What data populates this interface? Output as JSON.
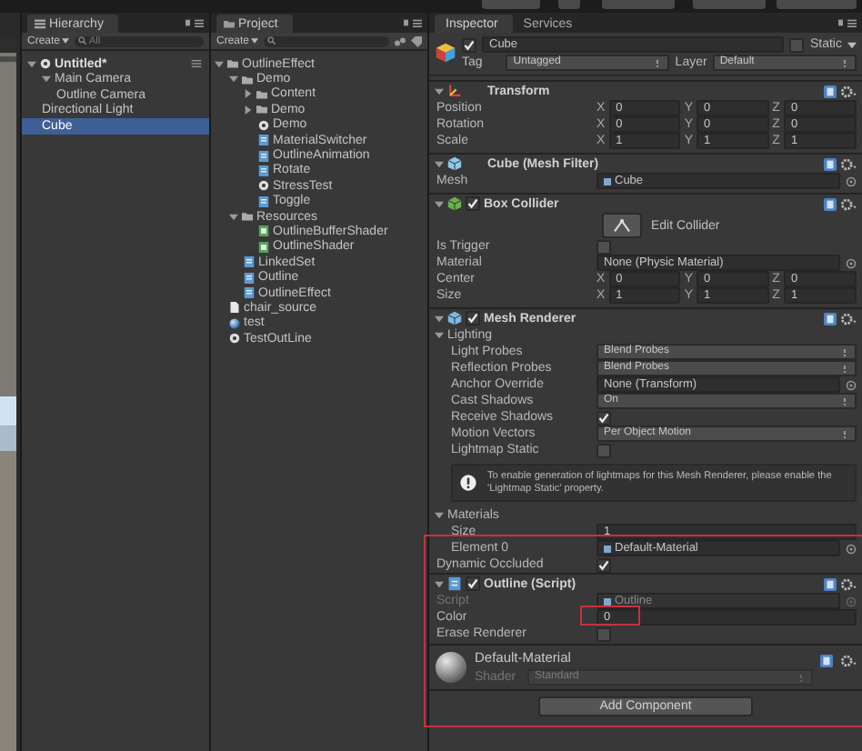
{
  "hierarchy": {
    "title": "Hierarchy",
    "create": "Create",
    "search_placeholder": "All",
    "items": [
      {
        "label": "Untitled*",
        "kind": "scene",
        "expanded": true,
        "selected": false,
        "children": [
          {
            "label": "Main Camera",
            "expanded": true,
            "selected": false,
            "children": [
              {
                "label": "Outline Camera",
                "selected": false
              }
            ]
          },
          {
            "label": "Directional Light",
            "selected": false
          },
          {
            "label": "Cube",
            "selected": true
          }
        ]
      }
    ]
  },
  "project": {
    "title": "Project",
    "create": "Create",
    "items": [
      {
        "label": "OutlineEffect",
        "kind": "folder",
        "expanded": true,
        "selected": false,
        "children": [
          {
            "label": "Demo",
            "kind": "folder",
            "expanded": true,
            "selected": false,
            "children": [
              {
                "label": "Content",
                "kind": "folder",
                "expanded": false,
                "selected": false
              },
              {
                "label": "Demo",
                "kind": "folder",
                "expanded": false,
                "selected": false
              },
              {
                "label": "Demo",
                "kind": "scene",
                "selected": false
              },
              {
                "label": "MaterialSwitcher",
                "kind": "script",
                "selected": false
              },
              {
                "label": "OutlineAnimation",
                "kind": "script",
                "selected": false
              },
              {
                "label": "Rotate",
                "kind": "script",
                "selected": false
              },
              {
                "label": "StressTest",
                "kind": "scene",
                "selected": false
              },
              {
                "label": "Toggle",
                "kind": "script",
                "selected": false
              }
            ]
          },
          {
            "label": "Resources",
            "kind": "folder",
            "expanded": true,
            "selected": false,
            "children": [
              {
                "label": "OutlineBufferShader",
                "kind": "shader",
                "selected": false
              },
              {
                "label": "OutlineShader",
                "kind": "shader",
                "selected": false
              }
            ]
          },
          {
            "label": "LinkedSet",
            "kind": "script",
            "selected": false
          },
          {
            "label": "Outline",
            "kind": "script",
            "selected": false
          },
          {
            "label": "OutlineEffect",
            "kind": "script",
            "selected": false
          }
        ]
      },
      {
        "label": "chair_source",
        "kind": "text",
        "selected": false
      },
      {
        "label": "test",
        "kind": "material",
        "selected": false
      },
      {
        "label": "TestOutLine",
        "kind": "scene",
        "selected": false
      }
    ]
  },
  "inspector": {
    "tabs": [
      {
        "label": "Inspector",
        "selected": true
      },
      {
        "label": "Services",
        "selected": false
      }
    ],
    "object": {
      "name": "Cube",
      "active": true,
      "static_label": "Static",
      "static": false,
      "tag_label": "Tag",
      "tag": "Untagged",
      "layer_label": "Layer",
      "layer": "Default"
    },
    "components": [
      {
        "kind": "transform",
        "title": "Transform",
        "rows": [
          {
            "kind": "vector",
            "label": "Position",
            "values": [
              {
                "axis": "X",
                "value": "0"
              },
              {
                "axis": "Y",
                "value": "0"
              },
              {
                "axis": "Z",
                "value": "0"
              }
            ]
          },
          {
            "kind": "vector",
            "label": "Rotation",
            "values": [
              {
                "axis": "X",
                "value": "0"
              },
              {
                "axis": "Y",
                "value": "0"
              },
              {
                "axis": "Z",
                "value": "0"
              }
            ]
          },
          {
            "kind": "vector",
            "label": "Scale",
            "values": [
              {
                "axis": "X",
                "value": "1"
              },
              {
                "axis": "Y",
                "value": "1"
              },
              {
                "axis": "Z",
                "value": "1"
              }
            ]
          }
        ]
      },
      {
        "kind": "mesh_filter",
        "title": "Cube (Mesh Filter)",
        "rows": [
          {
            "kind": "object",
            "label": "Mesh",
            "value": "Cube",
            "asset_icon": true,
            "disabled": false
          }
        ]
      },
      {
        "kind": "collider",
        "title": "Box Collider",
        "enabled": true,
        "rows": [
          {
            "kind": "button",
            "value": "Edit Collider"
          },
          {
            "kind": "checkbox",
            "label": "Is Trigger",
            "checked": false
          },
          {
            "kind": "object",
            "label": "Material",
            "value": "None (Physic Material)",
            "asset_icon": false,
            "disabled": false
          },
          {
            "kind": "vector",
            "label": "Center",
            "values": [
              {
                "axis": "X",
                "value": "0"
              },
              {
                "axis": "Y",
                "value": "0"
              },
              {
                "axis": "Z",
                "value": "0"
              }
            ]
          },
          {
            "kind": "vector",
            "label": "Size",
            "values": [
              {
                "axis": "X",
                "value": "1"
              },
              {
                "axis": "Y",
                "value": "1"
              },
              {
                "axis": "Z",
                "value": "1"
              }
            ]
          }
        ]
      },
      {
        "kind": "renderer",
        "title": "Mesh Renderer",
        "enabled": true,
        "rows": [
          {
            "kind": "section",
            "label": "Lighting",
            "expanded": true,
            "children": [
              {
                "kind": "dropdown",
                "label": "Light Probes",
                "value": "Blend Probes"
              },
              {
                "kind": "dropdown",
                "label": "Reflection Probes",
                "value": "Blend Probes"
              },
              {
                "kind": "object",
                "label": "Anchor Override",
                "value": "None (Transform)",
                "asset_icon": false,
                "disabled": false
              },
              {
                "kind": "dropdown",
                "label": "Cast Shadows",
                "value": "On"
              },
              {
                "kind": "checkbox",
                "label": "Receive Shadows",
                "checked": true
              },
              {
                "kind": "dropdown",
                "label": "Motion Vectors",
                "value": "Per Object Motion"
              },
              {
                "kind": "checkbox",
                "label": "Lightmap Static",
                "checked": false
              },
              {
                "kind": "info",
                "value": "To enable generation of lightmaps for this Mesh Renderer, please enable the 'Lightmap Static' property."
              }
            ]
          },
          {
            "kind": "section",
            "label": "Materials",
            "expanded": true,
            "children": [
              {
                "kind": "text",
                "label": "Size",
                "value": "1"
              },
              {
                "kind": "object",
                "label": "Element 0",
                "value": "Default-Material",
                "asset_icon": true,
                "disabled": false
              }
            ]
          },
          {
            "kind": "checkbox",
            "label": "Dynamic Occluded",
            "checked": true
          }
        ]
      },
      {
        "kind": "script",
        "title": "Outline (Script)",
        "enabled": true,
        "rows": [
          {
            "kind": "object",
            "label": "Script",
            "value": "Outline",
            "asset_icon": true,
            "disabled": true
          },
          {
            "kind": "text",
            "label": "Color",
            "value": "0"
          },
          {
            "kind": "checkbox",
            "label": "Erase Renderer",
            "checked": false
          }
        ]
      }
    ],
    "material": {
      "name": "Default-Material",
      "shader_label": "Shader",
      "shader": "Standard"
    },
    "add_component": "Add Component"
  }
}
